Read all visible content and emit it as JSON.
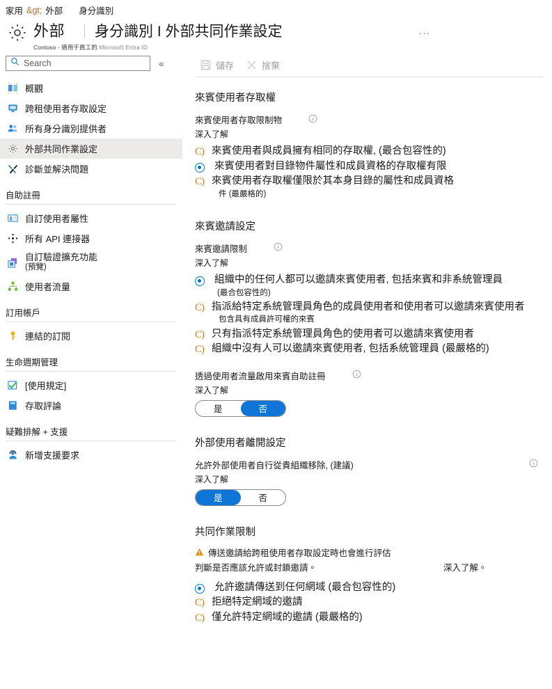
{
  "breadcrumb": {
    "items": [
      "家用",
      "外部",
      "身分識別"
    ],
    "separator": "&gt;"
  },
  "header": {
    "icon": "gear-icon",
    "title": "外部",
    "subtitle_title": "身分識別 I 外部共同作業設定",
    "org_line_bold": "Contoso - 適用于員工的",
    "org_line_dim": "Microsoft Entra ID",
    "overflow": "···"
  },
  "sidebar": {
    "search": {
      "placeholder": "Search",
      "value": "",
      "icon": "search-icon"
    },
    "collapse": {
      "label": "«",
      "icon": "chevron-double-left-icon"
    },
    "items": [
      {
        "label": "概觀",
        "icon": "overview-icon",
        "selected": false
      },
      {
        "label": "跨租使用者存取設定",
        "icon": "monitor-icon",
        "selected": false
      },
      {
        "label": "所有身分識別提供者",
        "icon": "people-icon",
        "selected": false
      },
      {
        "label": "外部共同作業設定",
        "icon": "gear-icon",
        "selected": true
      },
      {
        "label": "診斷並解決問題",
        "icon": "wrench-icon",
        "selected": false
      }
    ],
    "groups": [
      {
        "title": "自助註冊",
        "items": [
          {
            "label": "自訂使用者屬性",
            "sub": "",
            "icon": "id-card-icon"
          },
          {
            "label": "所有 API 連接器",
            "sub": "",
            "icon": "connector-icon"
          },
          {
            "label": "自訂驗證擴充功能",
            "sub": "(預覽)",
            "icon": "extension-icon"
          },
          {
            "label": "使用者流量",
            "sub": "",
            "icon": "flow-icon"
          }
        ]
      },
      {
        "title": "訂用帳戶",
        "items": [
          {
            "label": "連結的訂閱",
            "sub": "",
            "icon": "key-icon"
          }
        ]
      },
      {
        "title": "生命週期管理",
        "items": [
          {
            "label": "[使用規定]",
            "sub": "",
            "icon": "checkmark-icon"
          },
          {
            "label": "存取評論",
            "sub": "",
            "icon": "book-icon"
          }
        ]
      },
      {
        "title": "疑難排解 + 支援",
        "items": [
          {
            "label": "新增支援要求",
            "sub": "",
            "icon": "support-icon"
          }
        ]
      }
    ]
  },
  "toolbar": {
    "save": {
      "label": "儲存",
      "icon": "save-icon",
      "enabled": false
    },
    "discard": {
      "label": "捨棄",
      "icon": "close-icon",
      "enabled": false
    }
  },
  "main": {
    "sections": [
      {
        "title": "來賓使用者存取權",
        "field_label": "來賓使用者存取限制物",
        "learn_more": "深入了解",
        "options": [
          {
            "text": "來賓使用者與成員擁有相同的存取權,  (最合包容性的)",
            "sub": "",
            "selected": false
          },
          {
            "text": "來賓使用者對目錄物件屬性和成員資格的存取權有限",
            "sub": "",
            "selected": true
          },
          {
            "text": "來賓使用者存取權僅限於其本身目錄的屬性和成員資格",
            "sub": "件 (最嚴格的)",
            "selected": false
          }
        ]
      },
      {
        "title": "來賓邀請設定",
        "field_label": "來賓邀請限制",
        "learn_more": "深入了解",
        "options": [
          {
            "text": "組織中的任何人都可以邀請來賓使用者, 包括來賓和非系統管理員",
            "sub": "(最合包容性的)",
            "selected": true
          },
          {
            "text": "指派給特定系統管理員角色的成員使用者和使用者可以邀請來賓使用者",
            "sub": "包含具有成員許可權的來賓",
            "selected": false
          },
          {
            "text": "只有指派特定系統管理員角色的使用者可以邀請來賓使用者",
            "sub": "",
            "selected": false
          },
          {
            "text": "組織中沒有人可以邀請來賓使用者, 包括系統管理員 (最嚴格的)",
            "sub": "",
            "selected": false
          }
        ],
        "toggle_field": {
          "label": "透過使用者流量啟用來賓自助註冊",
          "learn_more": "深入了解",
          "yes": "是",
          "no": "否",
          "selected": "否"
        }
      },
      {
        "title": "外部使用者離開設定",
        "field_label": "允許外部使用者自行從貴組織移除, (建議)",
        "learn_more": "深入了解",
        "toggle": {
          "yes": "是",
          "no": "否",
          "selected": "是"
        }
      },
      {
        "title": "共同作業限制",
        "warning": {
          "icon": "warning-icon",
          "line1": "傳送邀請給跨租使用者存取設定時也會進行評估",
          "line2": "判斷是否應該允許或封鎖邀請。",
          "learn_more": "深入了解。"
        },
        "options": [
          {
            "text": "允許邀請傳送到任何網域 (最合包容性的)",
            "sub": "",
            "selected": true
          },
          {
            "text": "拒絕特定網域的邀請",
            "sub": "",
            "selected": false
          },
          {
            "text": "僅允許特定網域的邀請 (最嚴格的)",
            "sub": "",
            "selected": false
          }
        ]
      }
    ]
  },
  "colors": {
    "accent": "#0078d4",
    "toggle_on": "#0f76d8",
    "warning": "#d98f00",
    "selected_nav": "#edebe9",
    "radio_off_glyph": "#d08020"
  }
}
